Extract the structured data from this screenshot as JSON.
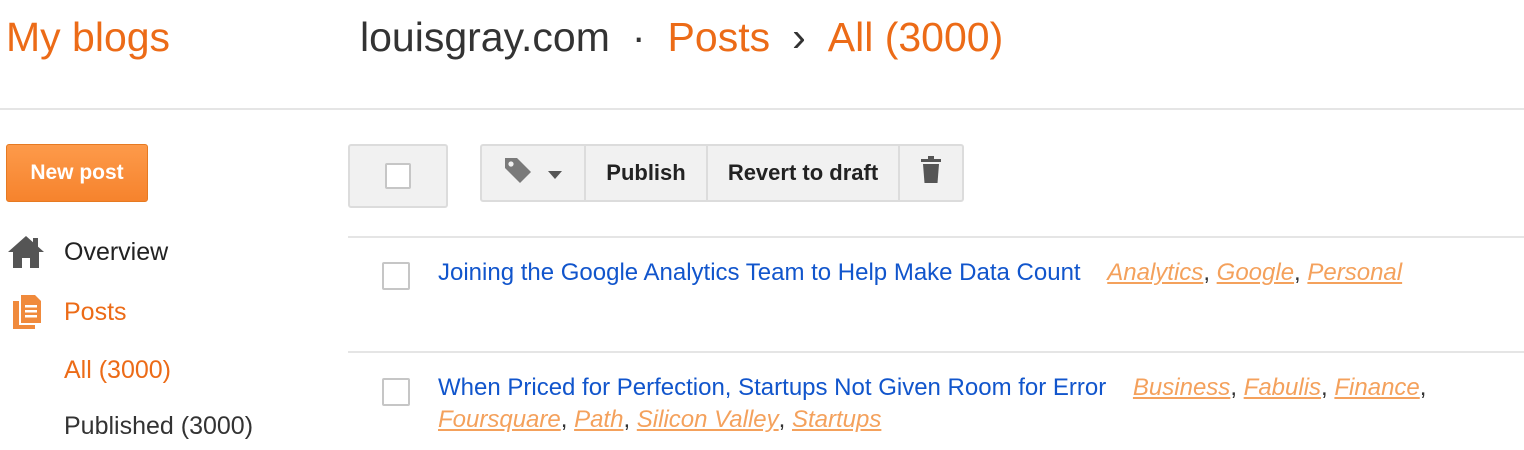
{
  "header": {
    "brand": "My blogs",
    "blog_name": "louisgray.com",
    "separator": "·",
    "section": "Posts",
    "chevron": "›",
    "filter": "All (3000)"
  },
  "sidebar": {
    "new_post_label": "New post",
    "items": [
      {
        "label": "Overview",
        "icon": "home-icon"
      },
      {
        "label": "Posts",
        "icon": "posts-icon"
      }
    ],
    "sub_items": [
      {
        "label": "All (3000)"
      },
      {
        "label": "Published (3000)"
      }
    ]
  },
  "toolbar": {
    "publish_label": "Publish",
    "revert_label": "Revert to draft",
    "labels_icon": "tag-icon",
    "delete_icon": "trash-icon"
  },
  "posts": [
    {
      "title": "Joining the Google Analytics Team to Help Make Data Count",
      "tags": [
        "Analytics",
        "Google",
        "Personal"
      ]
    },
    {
      "title": "When Priced for Perfection, Startups Not Given Room for Error",
      "tags": [
        "Business",
        "Fabulis",
        "Finance",
        "Foursquare",
        "Path",
        "Silicon Valley",
        "Startups"
      ]
    }
  ],
  "colors": {
    "accent": "#ec6b17",
    "link": "#1155cc",
    "tag": "#f4a15c",
    "button": "#f6832d"
  }
}
